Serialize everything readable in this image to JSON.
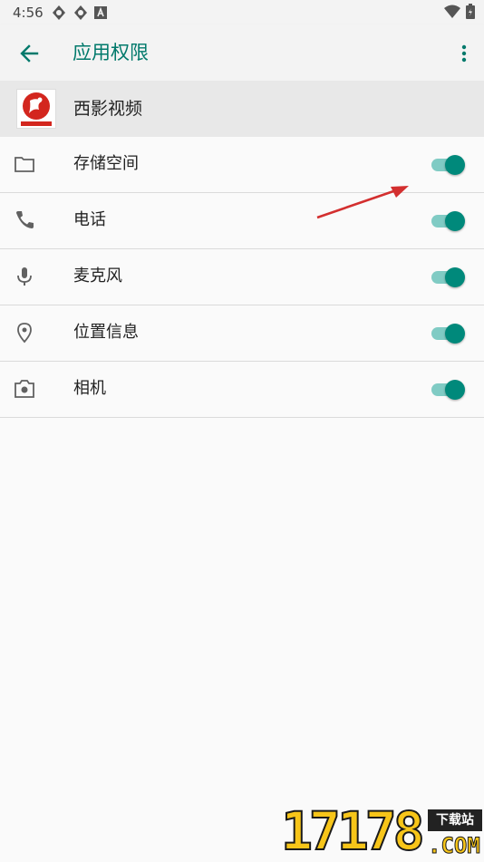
{
  "status_bar": {
    "time": "4:56",
    "icons": [
      "sync-icon",
      "sync-icon",
      "a-icon"
    ],
    "right_icons": [
      "wifi-icon",
      "battery-icon"
    ]
  },
  "app_bar": {
    "title": "应用权限",
    "back_icon": "arrow-back-icon",
    "more_icon": "more-vert-icon"
  },
  "app": {
    "name": "西影视频"
  },
  "permissions": [
    {
      "label": "存储空间",
      "icon": "folder-icon",
      "enabled": true
    },
    {
      "label": "电话",
      "icon": "phone-icon",
      "enabled": true
    },
    {
      "label": "麦克风",
      "icon": "mic-icon",
      "enabled": true
    },
    {
      "label": "位置信息",
      "icon": "location-icon",
      "enabled": true
    },
    {
      "label": "相机",
      "icon": "camera-icon",
      "enabled": true
    }
  ],
  "watermark": {
    "number": "17178",
    "tag": "下载站",
    "domain": ".COM"
  },
  "colors": {
    "accent": "#00796b",
    "switch_thumb": "#00897b",
    "switch_track": "#80cbc4",
    "annotation_arrow": "#d32f2f"
  }
}
